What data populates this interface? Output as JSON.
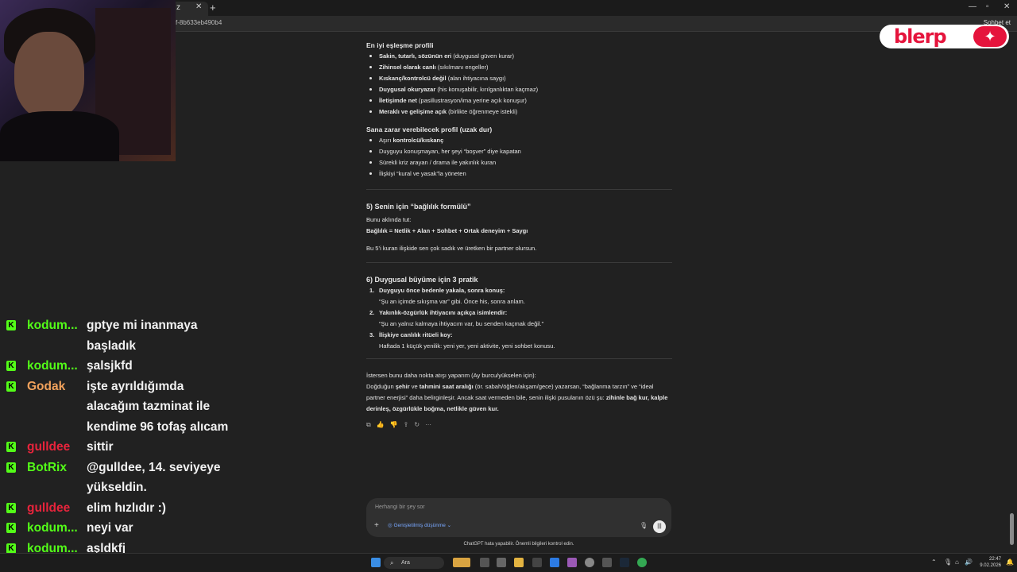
{
  "browser": {
    "tab_close": "✕",
    "new_tab": "+",
    "url": "f-8b633eb490b4",
    "header_right": "Sohbet et"
  },
  "overlay": {
    "blerp_logo": "blerp"
  },
  "conversation": {
    "best_match_title": "En iyi eşleşme profili",
    "best_match_items": [
      {
        "bold": "Sakin, tutarlı, sözünün eri",
        "rest": " (duygusal güven kurar)"
      },
      {
        "bold": "Zihinsel olarak canlı",
        "rest": " (sıkılmanı engeller)"
      },
      {
        "bold": "Kıskanç/kontrolcü değil",
        "rest": " (alan ihtiyacına saygı)"
      },
      {
        "bold": "Duygusal okuryazar",
        "rest": " (his konuşabilir, kırılganlıktan kaçmaz)"
      },
      {
        "bold": "İletişimde net",
        "rest": " (pasillustrasyon/ima yerine açık konuşur)"
      },
      {
        "bold": "Meraklı ve gelişime açık",
        "rest": " (birlikte öğrenmeye istekli)"
      }
    ],
    "harm_title": "Sana zarar verebilecek profil (uzak dur)",
    "harm_items": [
      {
        "pre": "Aşırı ",
        "bold": "kontrolcü/kıskanç",
        "rest": ""
      },
      {
        "pre": "Duyguyu konuşmayan, her şeyi “boşver” diye kapatan",
        "bold": "",
        "rest": ""
      },
      {
        "pre": "Sürekli kriz arayan / drama ile yakınlık kuran",
        "bold": "",
        "rest": ""
      },
      {
        "pre": "İlişkiyi “kural ve yasak”la yöneten",
        "bold": "",
        "rest": ""
      }
    ],
    "section5_title": "5) Senin için “bağlılık formülü”",
    "section5_intro": "Bunu aklında tut:",
    "section5_formula": "Bağlılık = Netlik + Alan + Sohbet + Ortak deneyim + Saygı",
    "section5_note": "Bu 5’i kuran ilişkide sen çok sadık ve üretken bir partner olursun.",
    "section6_title": "6) Duygusal büyüme için 3 pratik",
    "section6_items": [
      {
        "num": "1.",
        "title": "Duyguyu önce bedenle yakala, sonra konuş:",
        "text": "“Şu an içimde sıkışma var” gibi. Önce his, sonra anlam."
      },
      {
        "num": "2.",
        "title": "Yakınlık-özgürlük ihtiyacını açıkça isimlendir:",
        "text": "“Şu an yalnız kalmaya ihtiyacım var, bu senden kaçmak değil.”"
      },
      {
        "num": "3.",
        "title": "İlişkiye canlılık ritüeli koy:",
        "text": "Haftada 1 küçük yenilik: yeni yer, yeni aktivite, yeni sohbet konusu."
      }
    ],
    "closing_line1": "İstersen bunu daha nokta atışı yaparım (Ay burcu/yükselen için):",
    "closing_p_a": "Doğduğun ",
    "closing_p_b": "şehir",
    "closing_p_c": " ve ",
    "closing_p_d": "tahmini saat aralığı",
    "closing_p_e": " (ör. sabah/öğlen/akşam/gece) yazarsan, “bağlanma tarzın” ve “ideal partner enerjisi” daha belirginleşir. Ancak saat vermeden bile, senin ilişki pusulanın özü şu: ",
    "closing_p_f": "zihinle bağ kur, kalple derinleş, özgürlükle boğma, netlikle güven kur.",
    "actions": [
      "⧉",
      "👍",
      "👎",
      "⇪",
      "↻",
      "···"
    ]
  },
  "composer": {
    "placeholder": "Herhangi bir şey sor",
    "plus": "+",
    "tool_label": "◎ Genişletilmiş düşünme ⌄",
    "mic": "🎙",
    "voice": "|||"
  },
  "disclaimer": "ChatGPT hata yapabilir. Önemli bilgileri kontrol edin.",
  "chat_overlay": {
    "messages": [
      {
        "user": "kodum...",
        "color": "#53fc18",
        "text": "gptye mi inanmaya başladık"
      },
      {
        "user": "kodum...",
        "color": "#53fc18",
        "text": "şalsjkfd"
      },
      {
        "user": "Godak",
        "color": "#f2a25c",
        "text": "işte ayrıldığımda alacağım tazminat ile kendime 96 tofaş alıcam"
      },
      {
        "user": "gulldee",
        "color": "#e8243c",
        "text": "sittir"
      },
      {
        "user": "BotRix",
        "color": "#53fc18",
        "text": "@gulldee, 14. seviyeye yükseldin."
      },
      {
        "user": "gulldee",
        "color": "#e8243c",
        "text": "elim hızlıdır :)"
      },
      {
        "user": "kodum...",
        "color": "#53fc18",
        "text": "neyi var"
      },
      {
        "user": "kodum...",
        "color": "#53fc18",
        "text": "aşldkfj"
      }
    ]
  },
  "taskbar": {
    "search_label": "Ara",
    "time": "22:47",
    "date": "9.02.2026"
  }
}
